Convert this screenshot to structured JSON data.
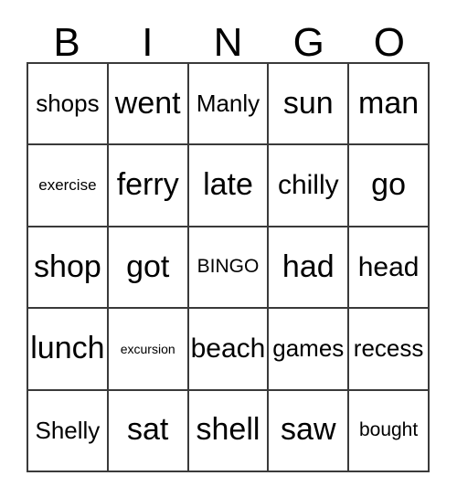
{
  "card": {
    "header_letters": [
      "B",
      "I",
      "N",
      "G",
      "O"
    ],
    "rows": [
      [
        {
          "text": "shops",
          "size": "m"
        },
        {
          "text": "went",
          "size": "xl"
        },
        {
          "text": "Manly",
          "size": "m"
        },
        {
          "text": "sun",
          "size": "xl"
        },
        {
          "text": "man",
          "size": "xl"
        }
      ],
      [
        {
          "text": "exercise",
          "size": "xs"
        },
        {
          "text": "ferry",
          "size": "xl"
        },
        {
          "text": "late",
          "size": "xl"
        },
        {
          "text": "chilly",
          "size": "l"
        },
        {
          "text": "go",
          "size": "xl"
        }
      ],
      [
        {
          "text": "shop",
          "size": "xl"
        },
        {
          "text": "got",
          "size": "xl"
        },
        {
          "text": "BINGO",
          "size": "s"
        },
        {
          "text": "had",
          "size": "xl"
        },
        {
          "text": "head",
          "size": "l"
        }
      ],
      [
        {
          "text": "lunch",
          "size": "xl"
        },
        {
          "text": "excursion",
          "size": "xxs"
        },
        {
          "text": "beach",
          "size": "l"
        },
        {
          "text": "games",
          "size": "m"
        },
        {
          "text": "recess",
          "size": "m"
        }
      ],
      [
        {
          "text": "Shelly",
          "size": "m"
        },
        {
          "text": "sat",
          "size": "xl"
        },
        {
          "text": "shell",
          "size": "xl"
        },
        {
          "text": "saw",
          "size": "xl"
        },
        {
          "text": "bought",
          "size": "s"
        }
      ]
    ],
    "free_space_label": "BINGO",
    "free_space_position": {
      "row": 2,
      "col": 2
    },
    "colors": {
      "background": "#ffffff",
      "text": "#000000",
      "border": "#3a3a3a"
    }
  }
}
